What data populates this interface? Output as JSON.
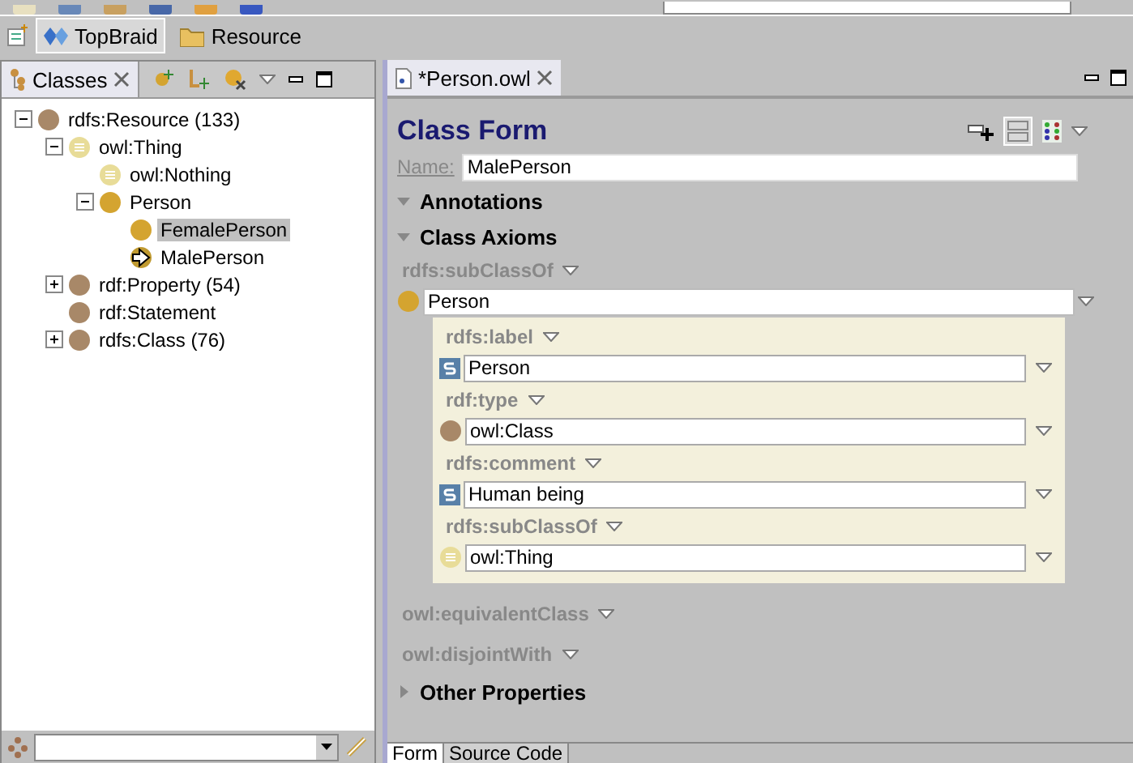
{
  "perspectives": [
    {
      "label": "TopBraid",
      "selected": true
    },
    {
      "label": "Resource",
      "selected": false
    }
  ],
  "classes_view": {
    "tab": "Classes",
    "tree": [
      {
        "label": "rdfs:Resource",
        "count": "(133)",
        "kind": "resource",
        "expanded": true,
        "selected": false,
        "children": [
          {
            "label": "owl:Thing",
            "kind": "thing",
            "expanded": true,
            "selected": false,
            "children": [
              {
                "label": "owl:Nothing",
                "kind": "thing",
                "selected": false
              },
              {
                "label": "Person",
                "kind": "class",
                "expanded": true,
                "selected": false,
                "children": [
                  {
                    "label": "FemalePerson",
                    "kind": "class",
                    "selected": true
                  },
                  {
                    "label": "MalePerson",
                    "kind": "current",
                    "selected": false
                  }
                ]
              }
            ]
          },
          {
            "label": "rdf:Property",
            "count": "(54)",
            "kind": "resource",
            "expanded": false,
            "selected": false
          },
          {
            "label": "rdf:Statement",
            "kind": "resource",
            "selected": false
          },
          {
            "label": "rdfs:Class",
            "count": "(76)",
            "kind": "resource",
            "expanded": false,
            "selected": false
          }
        ]
      }
    ]
  },
  "editor": {
    "tab": "*Person.owl",
    "title": "Class Form",
    "name_label": "Name:",
    "name_value": "MalePerson",
    "sections": [
      {
        "title": "Annotations",
        "expanded": true
      },
      {
        "title": "Class Axioms",
        "expanded": true
      }
    ],
    "axiom": {
      "property": "rdfs:subClassOf",
      "value": "Person",
      "kind": "class",
      "nested": [
        {
          "property": "rdfs:label",
          "value": "Person",
          "kind": "string"
        },
        {
          "property": "rdf:type",
          "value": "owl:Class",
          "kind": "resource"
        },
        {
          "property": "rdfs:comment",
          "value": "Human being",
          "kind": "string"
        },
        {
          "property": "rdfs:subClassOf",
          "value": "owl:Thing",
          "kind": "thing"
        }
      ]
    },
    "empty_properties": [
      "owl:equivalentClass",
      "owl:disjointWith"
    ],
    "other": {
      "title": "Other Properties",
      "expanded": false
    },
    "bottom_tabs": [
      {
        "label": "Form",
        "selected": true
      },
      {
        "label": "Source Code",
        "selected": false
      }
    ]
  }
}
